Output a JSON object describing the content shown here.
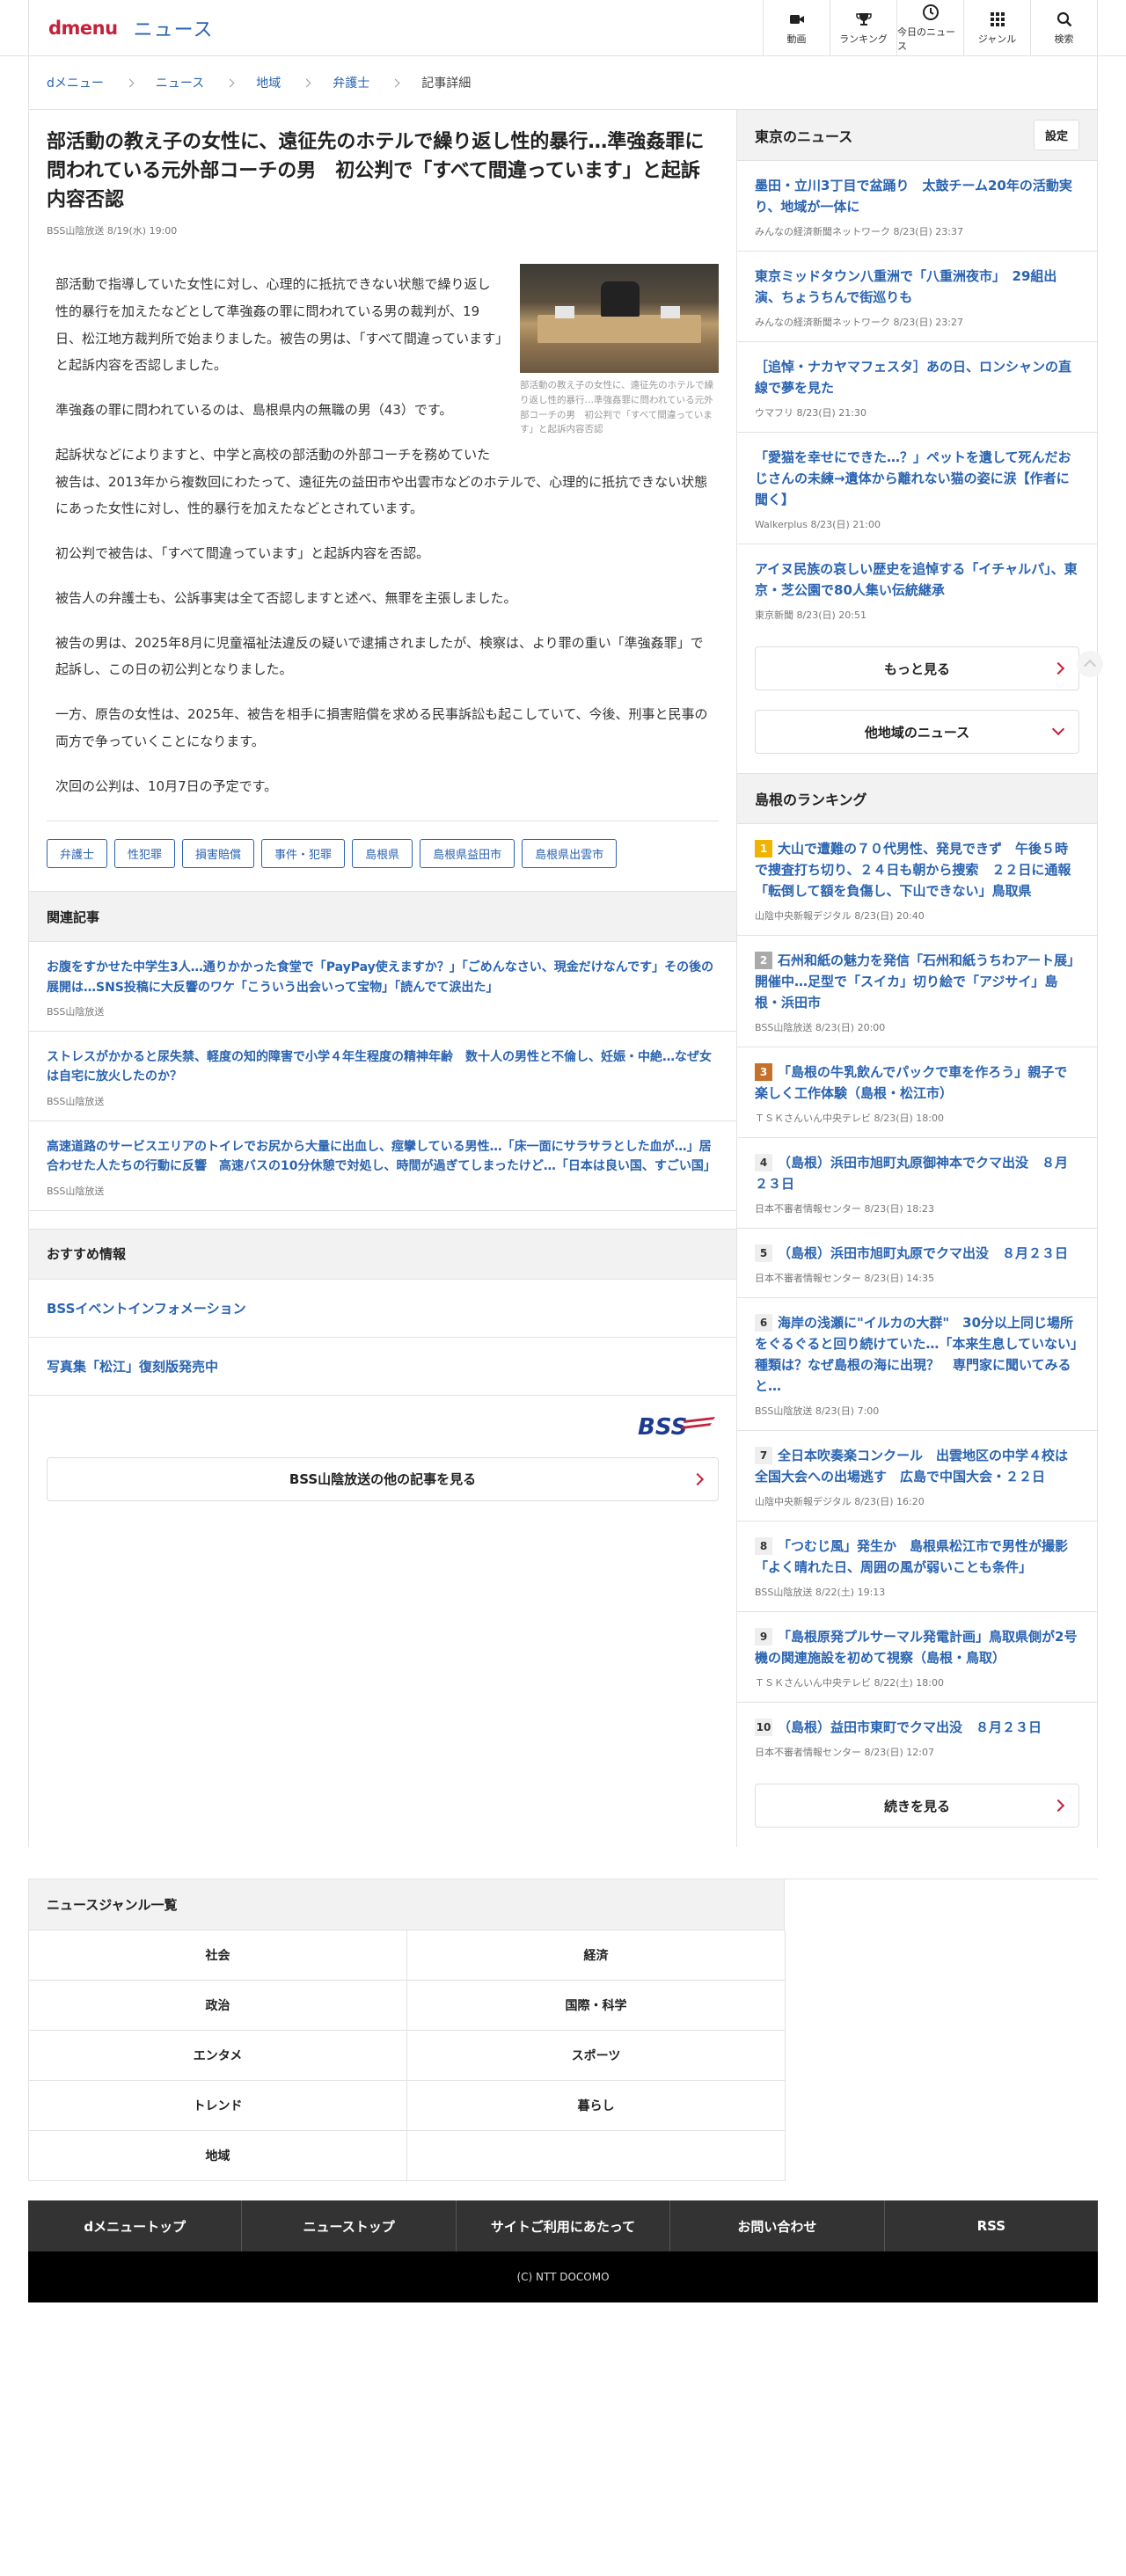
{
  "header": {
    "logo_d": "dmenu",
    "logo_news": "ニュース",
    "nav": [
      {
        "icon": "video-camera-icon",
        "label": "動画"
      },
      {
        "icon": "trophy-icon",
        "label": "ランキング"
      },
      {
        "icon": "clock-icon",
        "label": "今日のニュース"
      },
      {
        "icon": "grid-icon",
        "label": "ジャンル"
      },
      {
        "icon": "search-icon",
        "label": "検索"
      }
    ]
  },
  "breadcrumb": [
    "dメニュー",
    "ニュース",
    "地域",
    "弁護士",
    "記事詳細"
  ],
  "article": {
    "title": "部活動の教え子の女性に、遠征先のホテルで繰り返し性的暴行…準強姦罪に問われている元外部コーチの男　初公判で「すべて間違っています」と起訴内容否認",
    "meta": "BSS山陰放送  8/19(水) 19:00",
    "caption": "部活動の教え子の女性に、遠征先のホテルで繰り返し性的暴行…準強姦罪に問われている元外部コーチの男　初公判で「すべて間違っています」と起訴内容否認",
    "paragraphs": [
      "部活動で指導していた女性に対し、心理的に抵抗できない状態で繰り返し性的暴行を加えたなどとして準強姦の罪に問われている男の裁判が、19日、松江地方裁判所で始まりました。被告の男は、「すべて間違っています」と起訴内容を否認しました。",
      "準強姦の罪に問われているのは、島根県内の無職の男（43）です。",
      "起訴状などによりますと、中学と高校の部活動の外部コーチを務めていた被告は、2013年から複数回にわたって、遠征先の益田市や出雲市などのホテルで、心理的に抵抗できない状態にあった女性に対し、性的暴行を加えたなどとされています。",
      "初公判で被告は、「すべて間違っています」と起訴内容を否認。",
      "被告人の弁護士も、公訴事実は全て否認しますと述べ、無罪を主張しました。",
      "被告の男は、2025年8月に児童福祉法違反の疑いで逮捕されましたが、検察は、より罪の重い「準強姦罪」で起訴し、この日の初公判となりました。",
      "一方、原告の女性は、2025年、被告を相手に損害賠償を求める民事訴訟も起こしていて、今後、刑事と民事の両方で争っていくことになります。",
      "次回の公判は、10月7日の予定です。"
    ],
    "tags": [
      "弁護士",
      "性犯罪",
      "損害賠償",
      "事件・犯罪",
      "島根県",
      "島根県益田市",
      "島根県出雲市"
    ]
  },
  "related": {
    "heading": "関連記事",
    "items": [
      {
        "title": "お腹をすかせた中学生3人…通りかかった食堂で「PayPay使えますか？」「ごめんなさい、現金だけなんです」その後の展開は…SNS投稿に大反響のワケ「こういう出会いって宝物」「読んでて涙出た」",
        "source": "BSS山陰放送"
      },
      {
        "title": "ストレスがかかると尿失禁、軽度の知的障害で小学４年生程度の精神年齢　数十人の男性と不倫し、妊娠・中絶…なぜ女は自宅に放火したのか？",
        "source": "BSS山陰放送"
      },
      {
        "title": "高速道路のサービスエリアのトイレでお尻から大量に出血し、痙攣している男性…「床一面にサラサラとした血が…」居合わせた人たちの行動に反響　高速バスの10分休憩で対処し、時間が過ぎてしまったけど…「日本は良い国、すごい国」",
        "source": "BSS山陰放送"
      }
    ]
  },
  "recommend": {
    "heading": "おすすめ情報",
    "items": [
      "BSSイベントインフォメーション",
      "写真集「松江」復刻版発売中"
    ]
  },
  "provider_more": "BSS山陰放送の他の記事を見る",
  "tokyo": {
    "heading": "東京のニュース",
    "settings": "設定",
    "items": [
      {
        "title": "墨田・立川3丁目で盆踊り　太鼓チーム20年の活動実り、地域が一体に",
        "source": "みんなの経済新聞ネットワーク  8/23(日) 23:37"
      },
      {
        "title": "東京ミッドタウン八重洲で「八重洲夜市」　29組出演、ちょうちんで街巡りも",
        "source": "みんなの経済新聞ネットワーク  8/23(日) 23:27"
      },
      {
        "title": "［追悼・ナカヤマフェスタ］あの日、ロンシャンの直線で夢を見た",
        "source": "ウマフリ  8/23(日) 21:30"
      },
      {
        "title": "「愛猫を幸せにできた…？」ペットを遺して死んだおじさんの未練→遺体から離れない猫の姿に涙【作者に聞く】",
        "source": "Walkerplus  8/23(日) 21:00"
      },
      {
        "title": "アイヌ民族の哀しい歴史を追悼する「イチャルパ」、東京・芝公園で80人集い伝統継承",
        "source": "東京新聞  8/23(日) 20:51"
      }
    ],
    "more": "もっと見る",
    "other": "他地域のニュース"
  },
  "ranking": {
    "heading": "島根のランキング",
    "items": [
      {
        "rank": "1",
        "title": "大山で遭難の７０代男性、発見できず　午後５時で捜査打ち切り、２４日も朝から捜索　２２日に通報「転倒して額を負傷し、下山できない」鳥取県",
        "source": "山陰中央新報デジタル  8/23(日) 20:40"
      },
      {
        "rank": "2",
        "title": "石州和紙の魅力を発信「石州和紙うちわアート展」開催中…足型で「スイカ」切り絵で「アジサイ」島根・浜田市",
        "source": "BSS山陰放送  8/23(日) 20:00"
      },
      {
        "rank": "3",
        "title": "「島根の牛乳飲んでパックで車を作ろう」親子で楽しく工作体験（島根・松江市）",
        "source": "ＴＳＫさんいん中央テレビ  8/23(日) 18:00"
      },
      {
        "rank": "4",
        "title": "（島根）浜田市旭町丸原御神本でクマ出没　８月２３日",
        "source": "日本不審者情報センター  8/23(日) 18:23"
      },
      {
        "rank": "5",
        "title": "（島根）浜田市旭町丸原でクマ出没　８月２３日",
        "source": "日本不審者情報センター  8/23(日) 14:35"
      },
      {
        "rank": "6",
        "title": "海岸の浅瀬に\"イルカの大群\"　30分以上同じ場所をぐるぐると回り続けていた…「本来生息していない」種類は？なぜ島根の海に出現？　専門家に聞いてみると…",
        "source": "BSS山陰放送  8/23(日) 7:00"
      },
      {
        "rank": "7",
        "title": "全日本吹奏楽コンクール　出雲地区の中学４校は全国大会への出場逃す　広島で中国大会・２２日",
        "source": "山陰中央新報デジタル  8/23(日) 16:20"
      },
      {
        "rank": "8",
        "title": "「つむじ風」発生か　島根県松江市で男性が撮影「よく晴れた日、周囲の風が弱いことも条件」",
        "source": "BSS山陰放送  8/22(土) 19:13"
      },
      {
        "rank": "9",
        "title": "「島根原発プルサーマル発電計画」鳥取県側が2号機の関連施設を初めて視察（島根・鳥取）",
        "source": "ＴＳＫさんいん中央テレビ  8/22(土) 18:00"
      },
      {
        "rank": "10",
        "title": "（島根）益田市東町でクマ出没　８月２３日",
        "source": "日本不審者情報センター  8/23(日) 12:07"
      }
    ],
    "more": "続きを見る"
  },
  "genres": {
    "heading": "ニュースジャンル一覧",
    "items": [
      "社会",
      "経済",
      "政治",
      "国際・科学",
      "エンタメ",
      "スポーツ",
      "トレンド",
      "暮らし",
      "地域",
      ""
    ]
  },
  "footer": {
    "links": [
      "dメニュートップ",
      "ニューストップ",
      "サイトご利用にあたって",
      "お問い合わせ",
      "RSS"
    ],
    "copyright": "(C) NTT DOCOMO"
  },
  "colors": {
    "brand": "#c4213a",
    "link": "#2a63b0",
    "rank1": "#f0b400",
    "rank2": "#aaaaaa",
    "rank3": "#c8702a"
  }
}
